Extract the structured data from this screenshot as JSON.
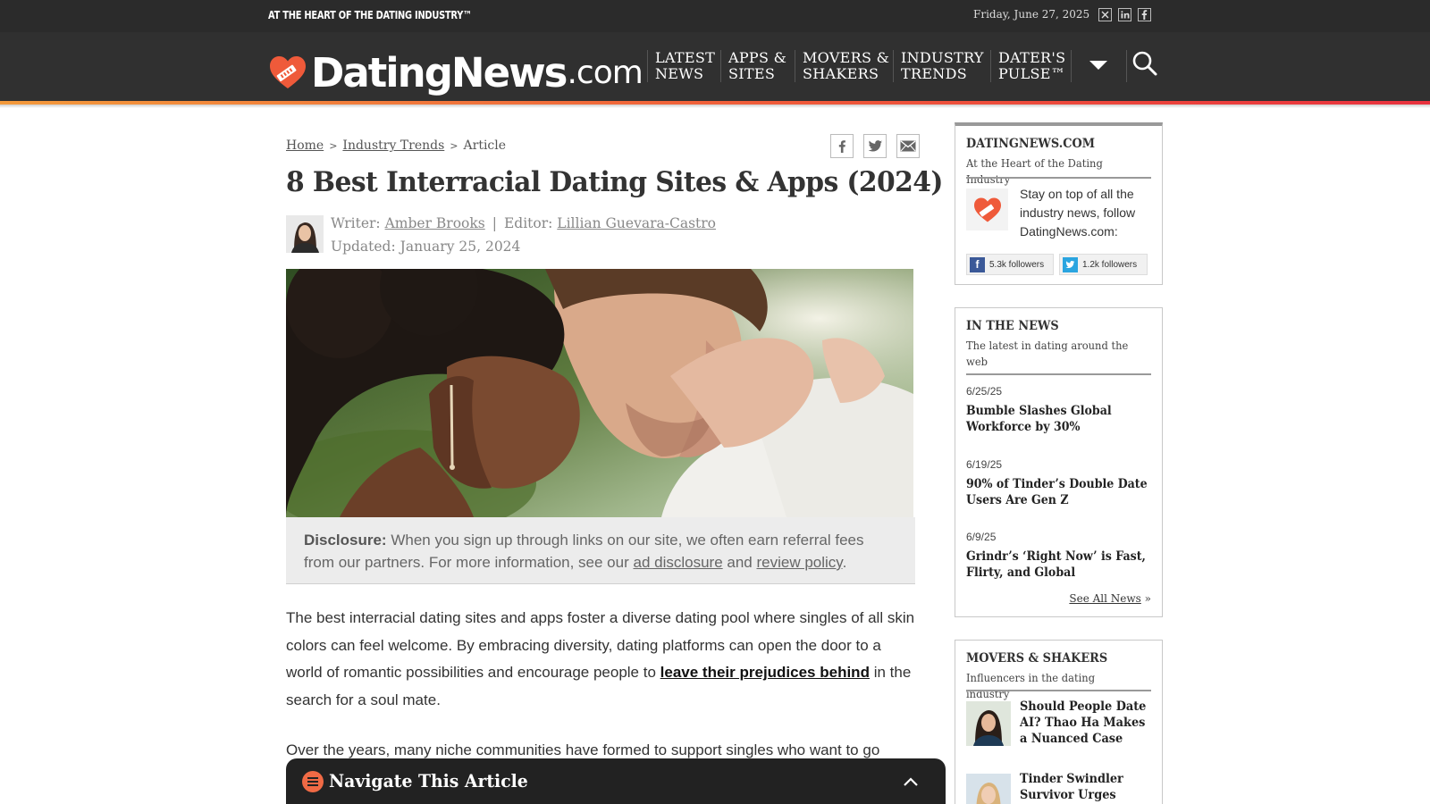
{
  "topbar": {
    "tagline": "AT THE HEART OF THE DATING INDUSTRY™",
    "date": "Friday, June 27, 2025",
    "social": [
      "x-icon",
      "linkedin-icon",
      "facebook-icon"
    ]
  },
  "header": {
    "brand": "DatingNews",
    "tld": ".com",
    "nav": [
      {
        "line1": "LATEST",
        "line2": "NEWS"
      },
      {
        "line1": "APPS &",
        "line2": "SITES"
      },
      {
        "line1": "MOVERS &",
        "line2": "SHAKERS"
      },
      {
        "line1": "INDUSTRY",
        "line2": "TRENDS"
      },
      {
        "line1": "DATER'S",
        "line2": "PULSE™"
      }
    ],
    "colors": {
      "bar": "#303030",
      "accent": "#ef5a3a"
    }
  },
  "breadcrumb": {
    "home": "Home",
    "section": "Industry Trends",
    "current": "Article",
    "separator": ">"
  },
  "article": {
    "title": "8 Best Interracial Dating Sites & Apps (2024)",
    "writer_label": "Writer:",
    "writer": "Amber Brooks",
    "divider": "|",
    "editor_label": "Editor:",
    "editor": "Lillian Guevara-Castro",
    "updated": "Updated: January 25, 2024",
    "disclosure": {
      "label": "Disclosure:",
      "text1": "When you sign up through links on our site, we often earn referral fees from our partners. For more information, see our",
      "link1": "ad disclosure",
      "and": "and",
      "link2": "review policy",
      "end": "."
    },
    "para1": {
      "text1": "The best interracial dating sites and apps foster a diverse dating pool where singles of all skin colors can feel welcome. By embracing diversity, dating platforms can open the door to a world of romantic possibilities and encourage people to",
      "link": "leave their prejudices behind",
      "text2": "in the search for a soul mate."
    },
    "para2": "Over the years, many niche communities have formed to support singles who want to go",
    "toc_label": "Navigate This Article"
  },
  "sidebar": {
    "follow": {
      "heading": "DATINGNEWS.COM",
      "sub": "At the Heart of the Dating Industry",
      "text": "Stay on top of all the industry news, follow DatingNews.com:",
      "facebook": "5.3k followers",
      "twitter": "1.2k followers"
    },
    "news": {
      "heading": "IN THE NEWS",
      "sub": "The latest in dating around the web",
      "items": [
        {
          "date": "6/25/25",
          "title": "Bumble Slashes Global Workforce by 30%"
        },
        {
          "date": "6/19/25",
          "title": "90% of Tinder’s Double Date Users Are Gen Z"
        },
        {
          "date": "6/9/25",
          "title": "Grindr’s ‘Right Now’ is Fast, Flirty, and Global"
        }
      ],
      "see_all": "See All News",
      "see_all_suffix": "»"
    },
    "movers": {
      "heading": "MOVERS & SHAKERS",
      "sub": "Influencers in the dating industry",
      "items": [
        {
          "title": "Should People Date AI? Thao Ha Makes a Nuanced Case"
        },
        {
          "title": "Tinder Swindler Survivor Urges"
        }
      ]
    }
  }
}
